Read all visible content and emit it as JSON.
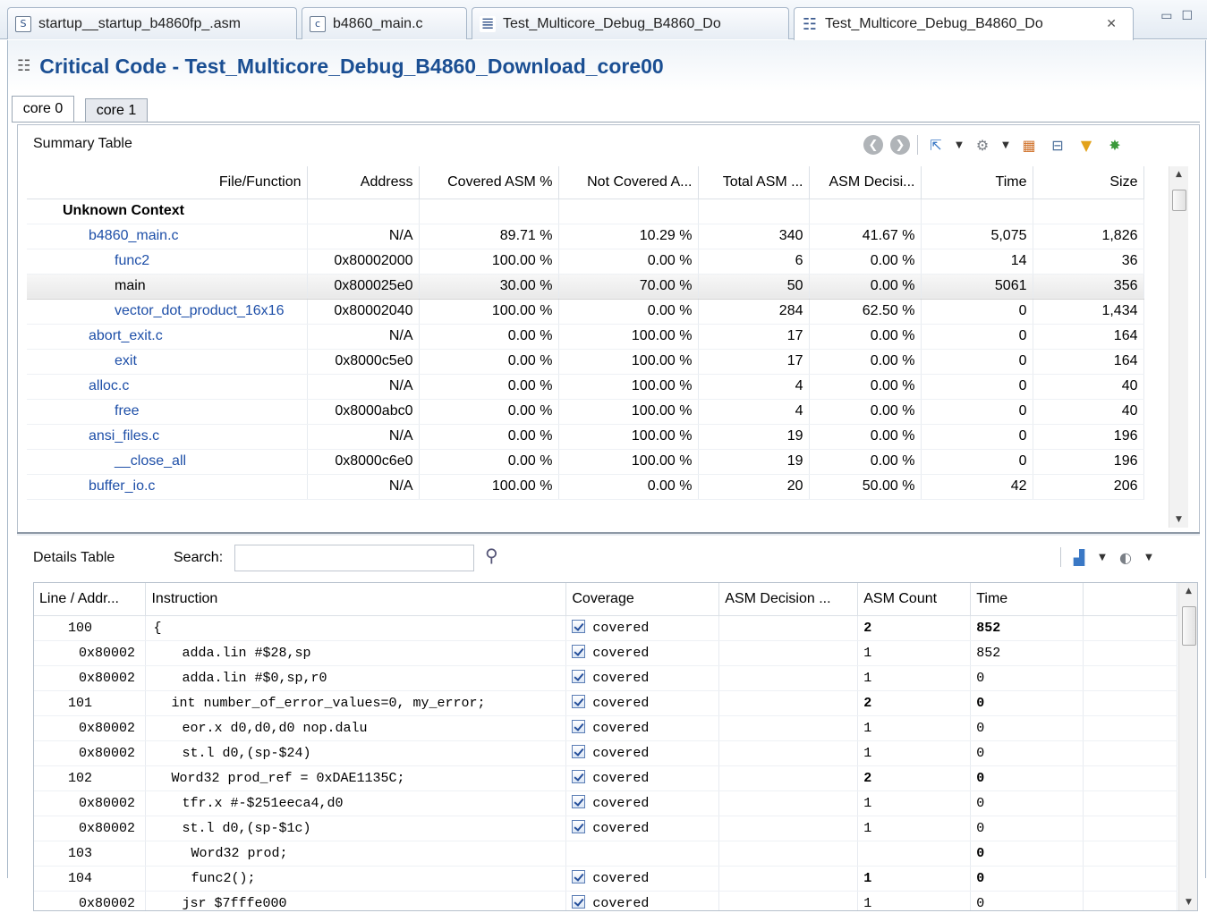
{
  "tabs": [
    {
      "label": "startup__startup_b4860fp_.asm",
      "icon": "asm-file-icon",
      "glyph": "S"
    },
    {
      "label": "b4860_main.c",
      "icon": "c-file-icon",
      "glyph": "c"
    },
    {
      "label": "Test_Multicore_Debug_B4860_Do",
      "icon": "report-icon",
      "glyph": "≣"
    },
    {
      "label": "Test_Multicore_Debug_B4860_Do",
      "icon": "table-report-icon",
      "glyph": "☷",
      "active": true
    }
  ],
  "header": {
    "title": "Critical Code - Test_Multicore_Debug_B4860_Download_core00"
  },
  "core_tabs": [
    "core 0",
    "core 1"
  ],
  "summary": {
    "title": "Summary Table",
    "columns": [
      "File/Function",
      "Address",
      "Covered ASM %",
      "Not Covered A...",
      "Total ASM ...",
      "ASM Decisi...",
      "Time",
      "Size"
    ],
    "rows": [
      {
        "cells": [
          "Unknown Context",
          "",
          "",
          "",
          "",
          "",
          "",
          ""
        ],
        "level": 0,
        "kind": "bold"
      },
      {
        "cells": [
          "b4860_main.c",
          "N/A",
          "89.71 %",
          "10.29 %",
          "340",
          "41.67 %",
          "5,075",
          "1,826"
        ],
        "level": 1,
        "kind": "link"
      },
      {
        "cells": [
          "func2",
          "0x80002000",
          "100.00 %",
          "0.00 %",
          "6",
          "0.00 %",
          "14",
          "36"
        ],
        "level": 2,
        "kind": "link"
      },
      {
        "cells": [
          "main",
          "0x800025e0",
          "30.00 %",
          "70.00 %",
          "50",
          "0.00 %",
          "5061",
          "356"
        ],
        "level": 2,
        "kind": "selected"
      },
      {
        "cells": [
          "vector_dot_product_16x16",
          "0x80002040",
          "100.00 %",
          "0.00 %",
          "284",
          "62.50 %",
          "0",
          "1,434"
        ],
        "level": 2,
        "kind": "link"
      },
      {
        "cells": [
          "abort_exit.c",
          "N/A",
          "0.00 %",
          "100.00 %",
          "17",
          "0.00 %",
          "0",
          "164"
        ],
        "level": 1,
        "kind": "link"
      },
      {
        "cells": [
          "exit",
          "0x8000c5e0",
          "0.00 %",
          "100.00 %",
          "17",
          "0.00 %",
          "0",
          "164"
        ],
        "level": 2,
        "kind": "link"
      },
      {
        "cells": [
          "alloc.c",
          "N/A",
          "0.00 %",
          "100.00 %",
          "4",
          "0.00 %",
          "0",
          "40"
        ],
        "level": 1,
        "kind": "link"
      },
      {
        "cells": [
          "free",
          "0x8000abc0",
          "0.00 %",
          "100.00 %",
          "4",
          "0.00 %",
          "0",
          "40"
        ],
        "level": 2,
        "kind": "link"
      },
      {
        "cells": [
          "ansi_files.c",
          "N/A",
          "0.00 %",
          "100.00 %",
          "19",
          "0.00 %",
          "0",
          "196"
        ],
        "level": 1,
        "kind": "link"
      },
      {
        "cells": [
          "__close_all",
          "0x8000c6e0",
          "0.00 %",
          "100.00 %",
          "19",
          "0.00 %",
          "0",
          "196"
        ],
        "level": 2,
        "kind": "link"
      },
      {
        "cells": [
          "buffer_io.c",
          "N/A",
          "100.00 %",
          "0.00 %",
          "20",
          "50.00 %",
          "42",
          "206"
        ],
        "level": 1,
        "kind": "link"
      }
    ]
  },
  "details": {
    "title": "Details Table",
    "search_label": "Search:",
    "search_value": "",
    "columns": [
      "Line / Addr...",
      "Instruction",
      "Coverage",
      "ASM Decision ...",
      "ASM Count",
      "Time"
    ],
    "rows": [
      {
        "line": "100",
        "instr": "{",
        "cov": "covered",
        "dec": "",
        "count": "2",
        "time": "852",
        "kind": "src"
      },
      {
        "line": "0x80002",
        "instr": "adda.lin #$28,sp",
        "cov": "covered",
        "dec": "",
        "count": "1",
        "time": "852",
        "kind": "asm"
      },
      {
        "line": "0x80002",
        "instr": "adda.lin #$0,sp,r0",
        "cov": "covered",
        "dec": "",
        "count": "1",
        "time": "0",
        "kind": "asm"
      },
      {
        "line": "101",
        "instr": "int number_of_error_values=0, my_error;",
        "cov": "covered",
        "dec": "",
        "count": "2",
        "time": "0",
        "kind": "src"
      },
      {
        "line": "0x80002",
        "instr": "eor.x d0,d0,d0 nop.dalu",
        "cov": "covered",
        "dec": "",
        "count": "1",
        "time": "0",
        "kind": "asm"
      },
      {
        "line": "0x80002",
        "instr": "st.l d0,(sp-$24)",
        "cov": "covered",
        "dec": "",
        "count": "1",
        "time": "0",
        "kind": "asm"
      },
      {
        "line": "102",
        "instr": "Word32 prod_ref = 0xDAE1135C;",
        "cov": "covered",
        "dec": "",
        "count": "2",
        "time": "0",
        "kind": "src"
      },
      {
        "line": "0x80002",
        "instr": "tfr.x #-$251eeca4,d0",
        "cov": "covered",
        "dec": "",
        "count": "1",
        "time": "0",
        "kind": "asm"
      },
      {
        "line": "0x80002",
        "instr": "st.l d0,(sp-$1c)",
        "cov": "covered",
        "dec": "",
        "count": "1",
        "time": "0",
        "kind": "asm"
      },
      {
        "line": "103",
        "instr": "Word32 prod;",
        "cov": "",
        "dec": "",
        "count": "",
        "time": "0",
        "kind": "src2"
      },
      {
        "line": "104",
        "instr": "func2();",
        "cov": "covered",
        "dec": "",
        "count": "1",
        "time": "0",
        "kind": "src2"
      },
      {
        "line": "0x80002",
        "instr": "jsr $7fffe000",
        "cov": "covered",
        "dec": "",
        "count": "1",
        "time": "0",
        "kind": "asm"
      }
    ]
  },
  "colors": {
    "title": "#1b4f93",
    "link": "#1e4fa8"
  }
}
